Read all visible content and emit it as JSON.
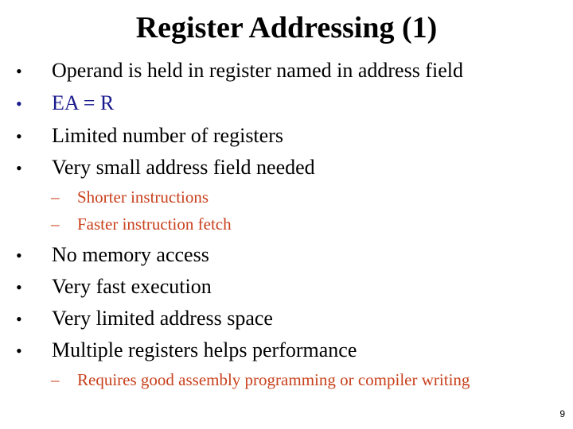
{
  "slide": {
    "title": "Register Addressing (1)",
    "bullets_group1": [
      {
        "text": "Operand is held in register named in address field",
        "color": "#000000"
      },
      {
        "text": "EA = R",
        "color": "#1a1a8c"
      },
      {
        "text": "Limited number of registers",
        "color": "#000000"
      },
      {
        "text": "Very small address field needed",
        "color": "#000000"
      }
    ],
    "sub_bullets_group1": [
      "Shorter instructions",
      "Faster instruction fetch"
    ],
    "bullets_group2": [
      {
        "text": "No memory access"
      },
      {
        "text": "Very fast execution"
      },
      {
        "text": "Very limited address space"
      },
      {
        "text": "Multiple registers helps performance"
      }
    ],
    "sub_bullets_group2": [
      "Requires good assembly programming or compiler writing"
    ],
    "bullet_glyph": "•",
    "dash_glyph": "–",
    "page_number": "9",
    "colors": {
      "highlight_blue": "#1a1a8c",
      "sub_bullet_orange": "#c8401c"
    }
  }
}
